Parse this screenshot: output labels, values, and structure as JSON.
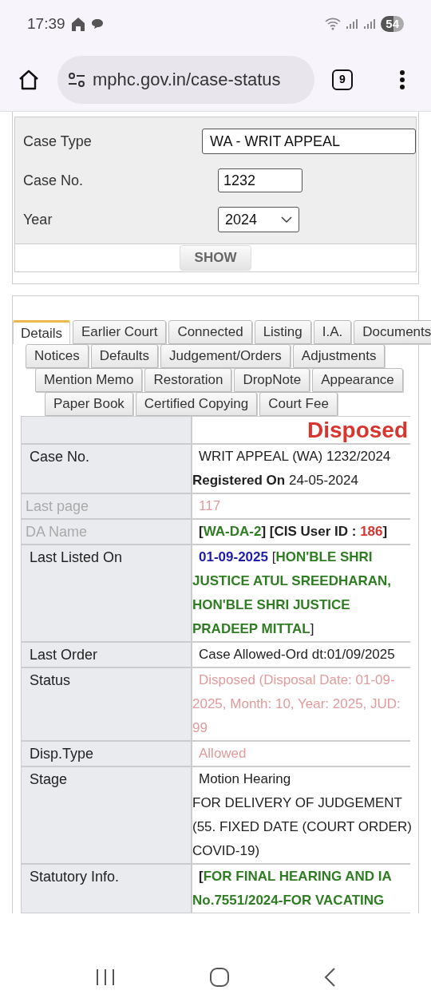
{
  "status_bar": {
    "time": "17:39",
    "battery": "54"
  },
  "browser": {
    "url": "mphc.gov.in/case-status",
    "tab_count": "9"
  },
  "search_form": {
    "fields": [
      {
        "label": "Case Type",
        "kind": "wide_select",
        "value": "WA - WRIT APPEAL"
      },
      {
        "label": "Case No.",
        "kind": "input",
        "value": "1232"
      },
      {
        "label": "Year",
        "kind": "select",
        "value": "2024"
      }
    ],
    "button": "SHOW"
  },
  "tab_rows": [
    [
      {
        "label": "Details",
        "selected": true
      },
      {
        "label": "Earlier Court",
        "selected": false
      },
      {
        "label": "Connected",
        "selected": false
      },
      {
        "label": "Listing",
        "selected": false
      },
      {
        "label": "I.A.",
        "selected": false
      },
      {
        "label": "Documents",
        "selected": false
      }
    ],
    [
      {
        "label": "Notices",
        "selected": false
      },
      {
        "label": "Defaults",
        "selected": false
      },
      {
        "label": "Judgement/Orders",
        "selected": false
      },
      {
        "label": "Adjustments",
        "selected": false
      }
    ],
    [
      {
        "label": "Mention Memo",
        "selected": false
      },
      {
        "label": "Restoration",
        "selected": false
      },
      {
        "label": "DropNote",
        "selected": false
      },
      {
        "label": "Appearance",
        "selected": false
      }
    ],
    [
      {
        "label": "Paper Book",
        "selected": false
      },
      {
        "label": "Certified Copying",
        "selected": false
      },
      {
        "label": "Court Fee",
        "selected": false
      }
    ]
  ],
  "case_details": {
    "status_banner": "Disposed",
    "rows": [
      {
        "label": "Case No.",
        "faded": false,
        "paragraphs": [
          [
            {
              "text": "WRIT APPEAL (WA) 1232/2024",
              "kind": "plain"
            }
          ],
          [
            {
              "text": "Registered On",
              "kind": "bold"
            },
            {
              "text": " 24-05-2024",
              "kind": "plain"
            }
          ]
        ]
      },
      {
        "label": "Last page",
        "faded": true,
        "paragraphs": [
          [
            {
              "text": "117",
              "kind": "faded"
            }
          ]
        ]
      },
      {
        "label": "DA Name",
        "faded": true,
        "paragraphs": [
          [
            {
              "text": " [",
              "kind": "bold"
            },
            {
              "text": "WA-DA-2",
              "kind": "green"
            },
            {
              "text": "] [CIS User ID : ",
              "kind": "bold"
            },
            {
              "text": "186",
              "kind": "red"
            },
            {
              "text": "]",
              "kind": "bold"
            }
          ]
        ]
      },
      {
        "label": "Last Listed On",
        "faded": false,
        "paragraphs": [
          [
            {
              "text": "01-09-2025",
              "kind": "blue"
            },
            {
              "text": " [",
              "kind": "plain"
            },
            {
              "text": "HON'BLE SHRI JUSTICE ATUL SREEDHARAN, HON'BLE SHRI JUSTICE PRADEEP MITTAL",
              "kind": "green"
            },
            {
              "text": "]",
              "kind": "plain"
            }
          ]
        ]
      },
      {
        "label": "Last Order",
        "faded": false,
        "paragraphs": [
          [
            {
              "text": "Case Allowed-Ord dt:01/09/2025",
              "kind": "plain"
            }
          ]
        ]
      },
      {
        "label": "Status",
        "faded": false,
        "paragraphs": [
          [
            {
              "text": "Disposed (Disposal Date: 01-09-2025, Month: 10, Year: 2025, JUD: 99",
              "kind": "faded"
            }
          ]
        ]
      },
      {
        "label": "Disp.Type",
        "faded": false,
        "paragraphs": [
          [
            {
              "text": "Allowed",
              "kind": "faded"
            }
          ]
        ]
      },
      {
        "label": "Stage",
        "faded": false,
        "paragraphs": [
          [
            {
              "text": "Motion Hearing",
              "kind": "plain"
            }
          ],
          [
            {
              "text": "FOR DELIVERY OF JUDGEMENT (55. FIXED DATE (COURT ORDER) COVID-19)",
              "kind": "plain"
            }
          ]
        ]
      },
      {
        "label": "Statutory Info.",
        "faded": false,
        "paragraphs": [
          [
            {
              "text": " [",
              "kind": "bold"
            },
            {
              "text": "FOR FINAL HEARING AND IA No.7551/2024-FOR VACATING",
              "kind": "green"
            }
          ]
        ]
      }
    ]
  }
}
